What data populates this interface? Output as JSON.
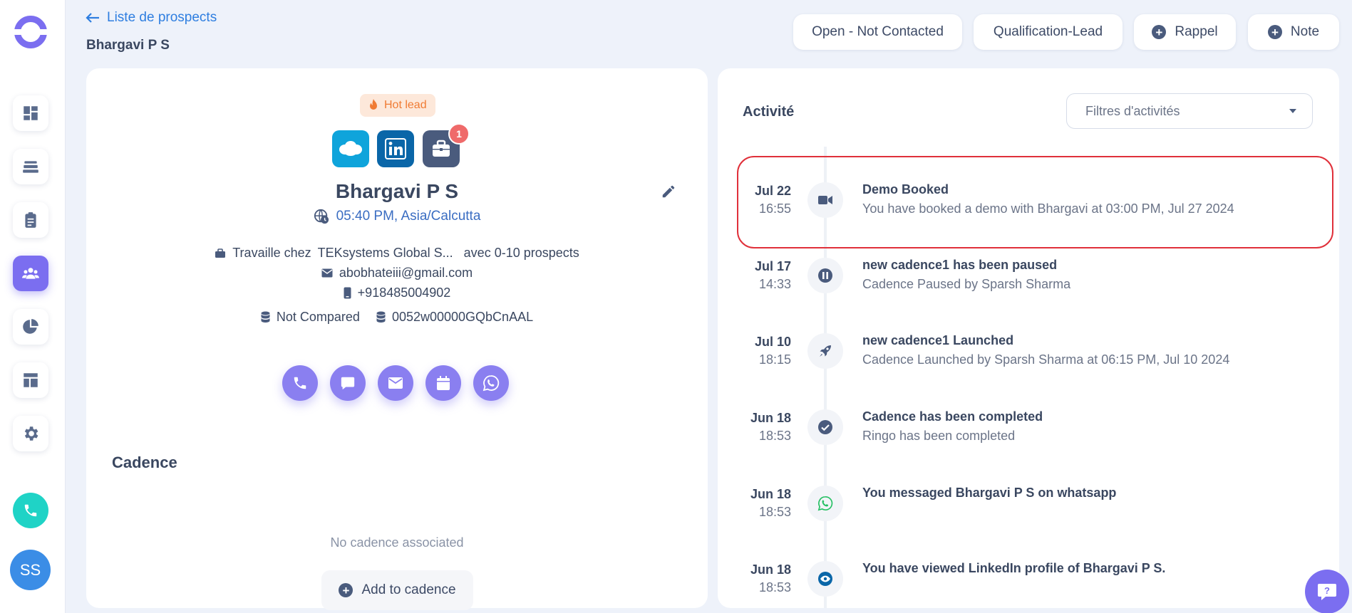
{
  "header": {
    "back_label": "Liste de prospects",
    "page_title": "Bhargavi P S",
    "status_button": "Open - Not Contacted",
    "stage_button": "Qualification-Lead",
    "reminder_button": "Rappel",
    "note_button": "Note"
  },
  "sidebar": {
    "items": [
      {
        "icon": "dashboard-icon"
      },
      {
        "icon": "layers-icon"
      },
      {
        "icon": "clipboard-icon"
      },
      {
        "icon": "people-icon",
        "active": true
      },
      {
        "icon": "pie-chart-icon"
      },
      {
        "icon": "layout-icon"
      },
      {
        "icon": "gear-icon"
      }
    ],
    "avatar_initials": "SS"
  },
  "lead": {
    "tag": "Hot lead",
    "badge_count": "1",
    "name": "Bhargavi P S",
    "local_time": "05:40 PM, Asia/Calcutta",
    "company_prefix": "Travaille chez",
    "company": "TEKsystems Global S...",
    "company_suffix": "avec 0-10 prospects",
    "email": "abobhateiii@gmail.com",
    "phone": "+918485004902",
    "compare_status": "Not Compared",
    "record_id": "0052w00000GQbCnAAL"
  },
  "cadence": {
    "title": "Cadence",
    "empty": "No cadence associated",
    "add_label": "Add to cadence"
  },
  "activity": {
    "title": "Activité",
    "filter_placeholder": "Filtres d'activités",
    "items": [
      {
        "date": "Jul 22",
        "time": "16:55",
        "title": "Demo Booked",
        "sub": "You have booked a demo with Bhargavi at 03:00 PM, Jul 27 2024",
        "icon": "video-icon"
      },
      {
        "date": "Jul 17",
        "time": "14:33",
        "title": "new cadence1 has been paused",
        "sub": "Cadence Paused by Sparsh Sharma",
        "icon": "pause-icon"
      },
      {
        "date": "Jul 10",
        "time": "18:15",
        "title": "new cadence1 Launched",
        "sub": "Cadence Launched by Sparsh Sharma at 06:15 PM, Jul 10 2024",
        "icon": "rocket-icon"
      },
      {
        "date": "Jun 18",
        "time": "18:53",
        "title": "Cadence has been completed",
        "sub": "Ringo has been completed",
        "icon": "check-circle-icon"
      },
      {
        "date": "Jun 18",
        "time": "18:53",
        "title": "You messaged Bhargavi P S on whatsapp",
        "sub": "",
        "icon": "whatsapp-icon"
      },
      {
        "date": "Jun 18",
        "time": "18:53",
        "title": "You have viewed LinkedIn profile of Bhargavi P S.",
        "sub": "",
        "icon": "eye-icon"
      }
    ]
  },
  "colors": {
    "accent": "#7b6ef0",
    "link": "#2e7ee0",
    "highlight": "#e0303a",
    "hot_lead": "#f07b33",
    "call": "#1fd3c6"
  }
}
